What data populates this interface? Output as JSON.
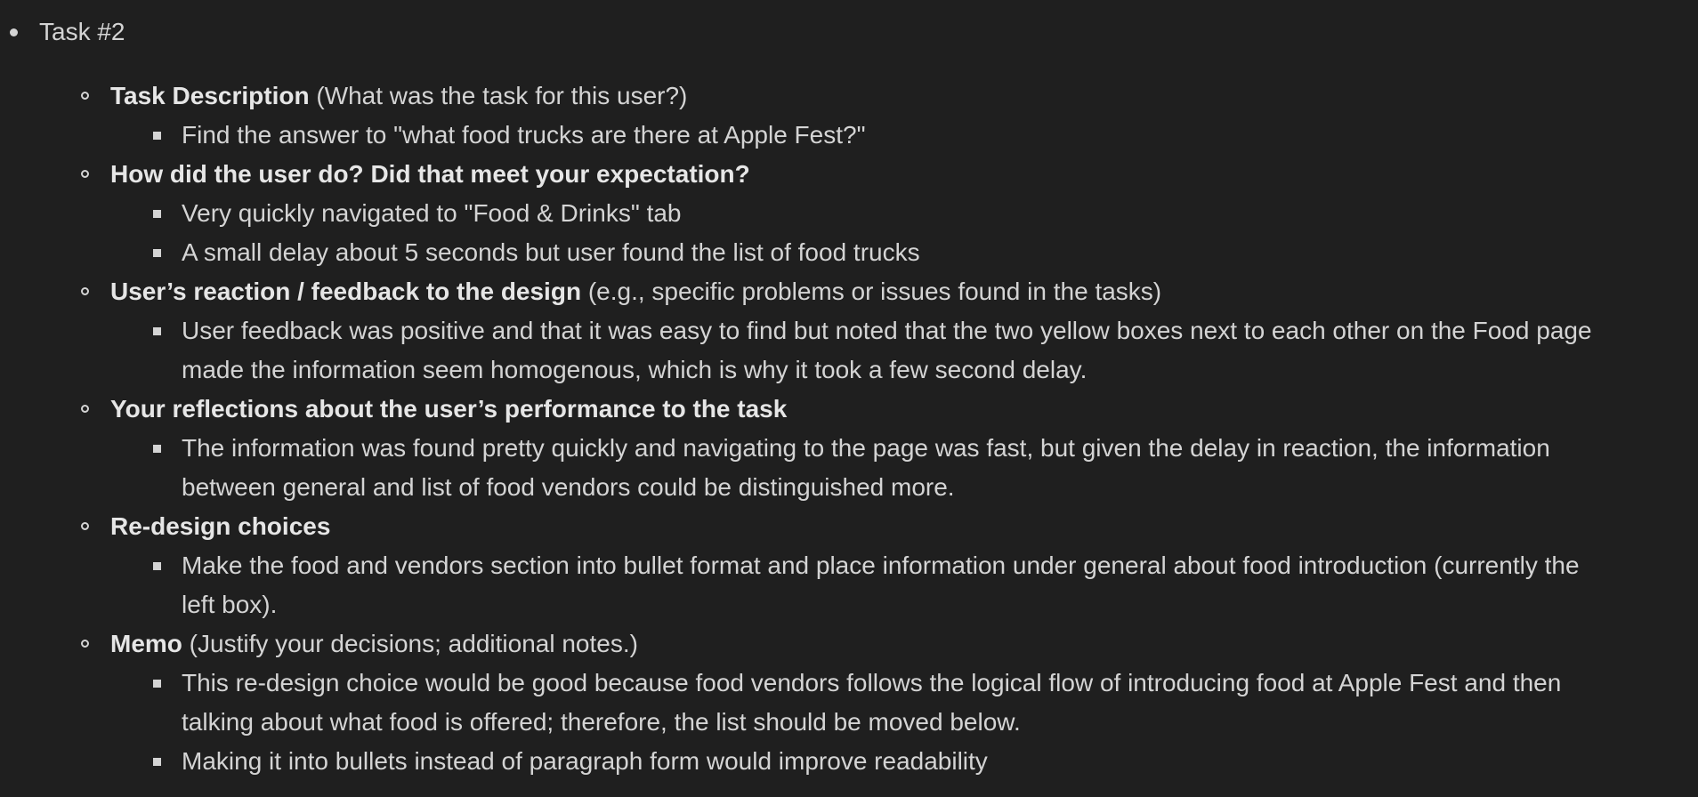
{
  "task": {
    "title": "Task #2",
    "sections": [
      {
        "heading": "Task Description",
        "note": " (What was the task for this user?)",
        "items": [
          [
            "Find the answer to \"what food trucks are there at Apple Fest?\""
          ]
        ]
      },
      {
        "heading": "How did the user do? Did that meet your expectation?",
        "note": "",
        "items": [
          [
            "Very quickly navigated to \"Food & Drinks\" tab"
          ],
          [
            "A small delay about 5 seconds but user found the list of food trucks"
          ]
        ]
      },
      {
        "heading": "User’s reaction / feedback to the design",
        "note": " (e.g., specific problems or issues found in the tasks)",
        "items": [
          [
            "User feedback was positive and that it was easy to find but noted that the two yellow boxes next to each other on the Food page",
            "made the information seem homogenous, which is why it took a few second delay."
          ]
        ]
      },
      {
        "heading": "Your reflections about the user’s performance to the task",
        "note": "",
        "items": [
          [
            "The information was found pretty quickly and navigating to the page was fast, but given the delay in reaction, the information",
            "between general and list of food vendors could be distinguished more."
          ]
        ]
      },
      {
        "heading": "Re-design choices",
        "note": "",
        "items": [
          [
            "Make the food and vendors section into bullet format and place information under general about food introduction (currently the",
            "left box)."
          ]
        ]
      },
      {
        "heading": "Memo",
        "note": " (Justify your decisions; additional notes.)",
        "items": [
          [
            "This re-design choice would be good because food vendors follows the logical flow of introducing food at Apple Fest and then",
            "talking about what food is offered; therefore, the list should be moved below."
          ],
          [
            "Making it into bullets instead of paragraph form would improve readability"
          ]
        ]
      }
    ]
  }
}
